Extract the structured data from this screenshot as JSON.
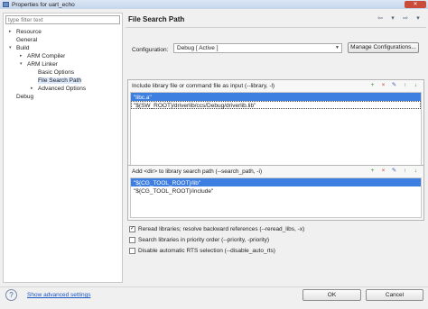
{
  "window": {
    "title": "Properties for uart_echo",
    "close_glyph": "✕"
  },
  "left": {
    "filter_placeholder": "type filter text",
    "tree": [
      {
        "label": "Resource",
        "twisty": "▸"
      },
      {
        "label": "General",
        "twisty": ""
      },
      {
        "label": "Build",
        "twisty": "▾"
      },
      {
        "label": "ARM Compiler",
        "twisty": "▸"
      },
      {
        "label": "ARM Linker",
        "twisty": "▾"
      },
      {
        "label": "Basic Options",
        "twisty": ""
      },
      {
        "label": "File Search Path",
        "twisty": ""
      },
      {
        "label": "Advanced Options",
        "twisty": "▸"
      },
      {
        "label": "Debug",
        "twisty": ""
      }
    ]
  },
  "main": {
    "title": "File Search Path",
    "nav": [
      "⇦",
      "▾",
      "⇨",
      "▾"
    ],
    "configuration": {
      "label": "Configuration:",
      "value": "Debug  [ Active ]"
    },
    "manage_button": "Manage Configurations...",
    "include_group": {
      "title": "Include library file or command file as input (--library, -l)",
      "items": [
        "\"libc.a\"",
        "\"${SW_ROOT}/driverlib/ccs/Debug/driverlib.lib\""
      ]
    },
    "search_group": {
      "title": "Add <dir> to library search path (--search_path, -i)",
      "items": [
        "\"${CG_TOOL_ROOT}/lib\"",
        "\"${CG_TOOL_ROOT}/include\""
      ]
    },
    "tools": [
      "+",
      "×",
      "✎",
      "↑",
      "↓"
    ],
    "options": [
      {
        "label": "Reread libraries; resolve backward references (--reread_libs, -x)",
        "checked": true
      },
      {
        "label": "Search libraries in priority order (--priority, -priority)",
        "checked": false
      },
      {
        "label": "Disable automatic RTS selection (--disable_auto_rts)",
        "checked": false
      }
    ]
  },
  "footer": {
    "help": "?",
    "advanced_link": "Show advanced settings",
    "ok": "OK",
    "cancel": "Cancel"
  }
}
